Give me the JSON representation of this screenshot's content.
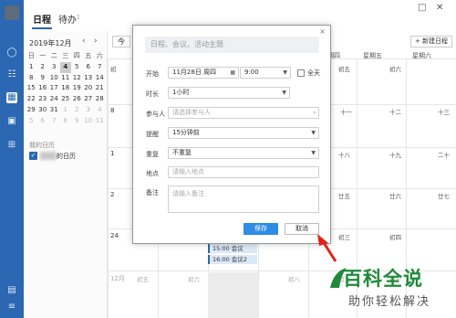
{
  "topbar": {
    "tabs": [
      {
        "label": "日程"
      },
      {
        "label": "待办"
      }
    ],
    "todo_count": "1"
  },
  "leftpane": {
    "month_label": "2019年12月",
    "weekday_heads": [
      "日",
      "一",
      "二",
      "三",
      "四",
      "五",
      "六"
    ],
    "weeks": [
      [
        "1",
        "2",
        "3",
        "4",
        "5",
        "6",
        "7"
      ],
      [
        "8",
        "9",
        "10",
        "11",
        "12",
        "13",
        "14"
      ],
      [
        "15",
        "16",
        "17",
        "18",
        "19",
        "20",
        "21"
      ],
      [
        "22",
        "23",
        "24",
        "25",
        "26",
        "27",
        "28"
      ],
      [
        "29",
        "30",
        "31",
        "1",
        "2",
        "3",
        "4"
      ],
      [
        "5",
        "6",
        "7",
        "8",
        "9",
        "10",
        "11"
      ]
    ],
    "my_calendars_title": "我的日历",
    "my_calendar_name": "的日历"
  },
  "main": {
    "today_label": "今",
    "new_event_label": "+ 新建日程",
    "weekday_heads": {
      "thu": "星期四",
      "fri": "星期五",
      "sat": "星期六"
    },
    "cells": {
      "r1": {
        "first_lunar": "初",
        "n1": "初五",
        "n2": "初六"
      },
      "r2": {
        "left": "8",
        "a": "十一",
        "b": "十二",
        "c": "十三"
      },
      "r3": {
        "left": "1",
        "a": "十八",
        "b": "十九",
        "c": "二十"
      },
      "r4": {
        "left": "2",
        "a": "廿五",
        "b": "廿六",
        "c": "廿七"
      },
      "r5": {
        "left": "24",
        "a": "初三",
        "b": "初四"
      },
      "r6": {
        "m": "12月",
        "l1": "初五",
        "l2": "初六",
        "l3": "初八",
        "l4": "初九",
        "l5": "初十"
      }
    },
    "events": [
      "15:00 会议",
      "16:00 会议2"
    ]
  },
  "dialog": {
    "close_label": "×",
    "title_placeholder": "日程、会议、活动主题",
    "start_label": "开始",
    "start_date": "11月28日 周四",
    "start_time": "9:00",
    "allday_label": "全天",
    "duration_label": "时长",
    "duration_value": "1小时",
    "participants_label": "参与人",
    "participants_placeholder": "请选择参与人",
    "reminder_label": "提醒",
    "reminder_value": "15分钟前",
    "repeat_label": "重复",
    "repeat_value": "不重复",
    "location_label": "地点",
    "location_placeholder": "请输入地点",
    "note_label": "备注",
    "note_placeholder": "请输入备注",
    "save_label": "保存",
    "cancel_label": "取消"
  },
  "watermark": {
    "title": "百科全说",
    "subtitle": "助你轻松解决"
  },
  "colors": {
    "sidebar": "#2b67b2",
    "primary_button": "#2e8ce6",
    "watermark_green": "#1f8a3a",
    "arrow_red": "#e0231c"
  },
  "icons": [
    "chat-icon",
    "calendar-icon",
    "document-icon",
    "apps-icon",
    "menu-icon",
    "contacts-icon",
    "square-icon",
    "close-icon"
  ]
}
